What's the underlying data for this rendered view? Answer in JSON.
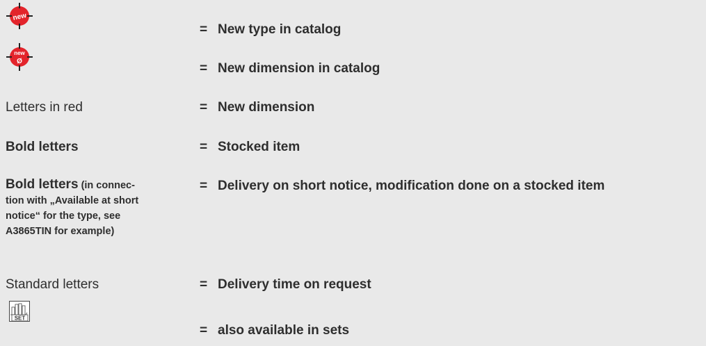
{
  "legend": {
    "new_type": {
      "badge_text": "new",
      "definition": "New type in catalog"
    },
    "new_dimension_badge": {
      "badge_text": "new",
      "symbol": "Ø",
      "definition": "New dimension in catalog"
    },
    "letters_red": {
      "term": "Letters in red",
      "definition": "New dimension"
    },
    "bold_letters": {
      "term": "Bold letters",
      "definition": "Stocked item"
    },
    "bold_short_notice": {
      "term_bold": "Bold letters",
      "term_note_1": "(in connec-",
      "term_note_2": "tion with „Available at short",
      "term_note_3": "notice“ for the type, see",
      "term_note_4": "A3865TIN for example)",
      "definition": "Delivery on short notice, modification done on a stocked item"
    },
    "standard_letters": {
      "term": "Standard letters",
      "definition": "Delivery time on request"
    },
    "sets": {
      "icon_text": "SET",
      "definition": "also available in sets"
    },
    "equals": "="
  },
  "colors": {
    "background": "#e9e9e9",
    "text": "#2e2e2e",
    "badge_red": "#e3242b"
  }
}
